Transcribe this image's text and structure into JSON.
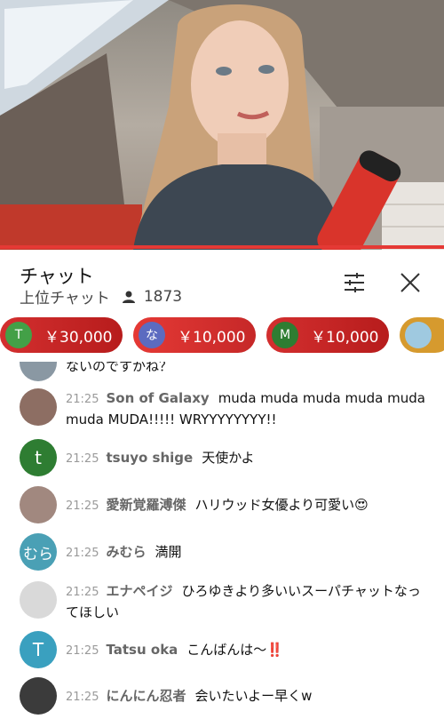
{
  "chat": {
    "title": "チャット",
    "mode": "上位チャット",
    "viewer_count": "1873"
  },
  "superchats": [
    {
      "initial": "T",
      "amount": "￥30,000",
      "avatar_color": "#43a047",
      "left_color": "#d32f2f",
      "right_color": "#b71c1c"
    },
    {
      "initial": "な",
      "amount": "￥10,000",
      "avatar_color": "#5c6bc0",
      "left_color": "#e53935",
      "right_color": "#c62828"
    },
    {
      "initial": "M",
      "amount": "￥10,000",
      "avatar_color": "#2e7d32",
      "left_color": "#d32f2f",
      "right_color": "#b71c1c"
    }
  ],
  "partial_message": "ないのですかね？",
  "messages": [
    {
      "time": "21:25",
      "author": "Son of Galaxy",
      "text": "muda muda muda muda muda muda MUDA!!!!! WRYYYYYYYY!!",
      "initial": "",
      "avatar_color": "#8d6e63"
    },
    {
      "time": "21:25",
      "author": "tsuyo shige",
      "text": "天使かよ",
      "initial": "t",
      "avatar_color": "#2e7d32"
    },
    {
      "time": "21:25",
      "author": "愛新覚羅溥傑",
      "text": "ハリウッド女優より可愛い😍",
      "initial": "",
      "avatar_color": "#a1887f"
    },
    {
      "time": "21:25",
      "author": "みむら",
      "text": "満開",
      "initial": "むら",
      "avatar_color": "#4aa0b5"
    },
    {
      "time": "21:25",
      "author": "エナペイジ",
      "text": "ひろゆきより多いいスーパチャットなってほしい",
      "initial": "",
      "avatar_color": "#d9d9d9"
    },
    {
      "time": "21:25",
      "author": "Tatsu oka",
      "text": "こんばんは〜‼️",
      "initial": "T",
      "avatar_color": "#3aa0bf"
    },
    {
      "time": "21:25",
      "author": "にんにん忍者",
      "text": "会いたいよー早くw",
      "initial": "",
      "avatar_color": "#3b3b3b"
    }
  ]
}
